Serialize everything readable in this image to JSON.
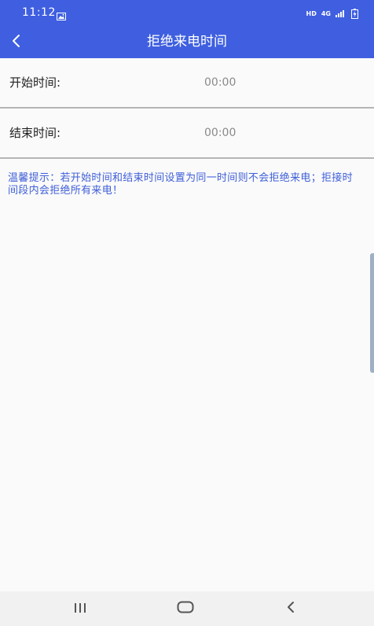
{
  "status_bar": {
    "time": "11:12",
    "hd_label": "HD",
    "network_label": "4G"
  },
  "app_bar": {
    "title": "拒绝来电时间"
  },
  "rows": [
    {
      "label": "开始时间:",
      "value": "00:00"
    },
    {
      "label": "结束时间:",
      "value": "00:00"
    }
  ],
  "hint": {
    "text": "温馨提示：若开始时间和结束时间设置为同一时间则不会拒绝来电；拒接时间段内会拒绝所有来电！"
  },
  "colors": {
    "primary": "#3f5fe0",
    "hint_text": "#3f5fd8",
    "value_text": "#8a8a8a",
    "divider": "#b5b5b5"
  }
}
